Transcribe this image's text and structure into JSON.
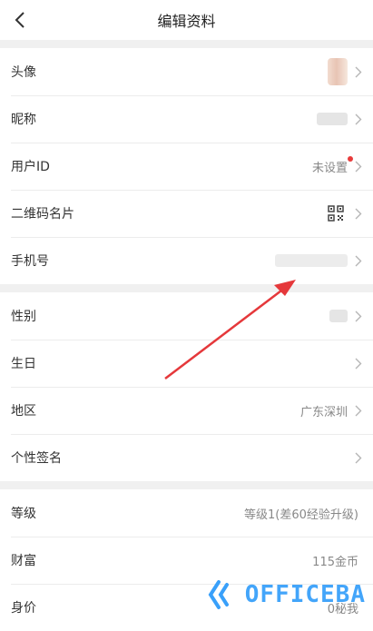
{
  "header": {
    "title": "编辑资料"
  },
  "section1": {
    "avatar_label": "头像",
    "nickname_label": "昵称",
    "userid_label": "用户ID",
    "userid_value": "未设置",
    "qrcode_label": "二维码名片",
    "phone_label": "手机号"
  },
  "section2": {
    "gender_label": "性别",
    "birthday_label": "生日",
    "region_label": "地区",
    "region_value": "广东深圳",
    "signature_label": "个性签名"
  },
  "section3": {
    "level_label": "等级",
    "level_value": "等级1(差60经验升级)",
    "wealth_label": "财富",
    "wealth_value": "115金币",
    "worth_label": "身价",
    "worth_value": "0秘我"
  },
  "watermark": {
    "text": "OFFICEBA"
  },
  "colors": {
    "accent_red": "#e83b3b",
    "watermark_blue": "#39a0fa"
  }
}
